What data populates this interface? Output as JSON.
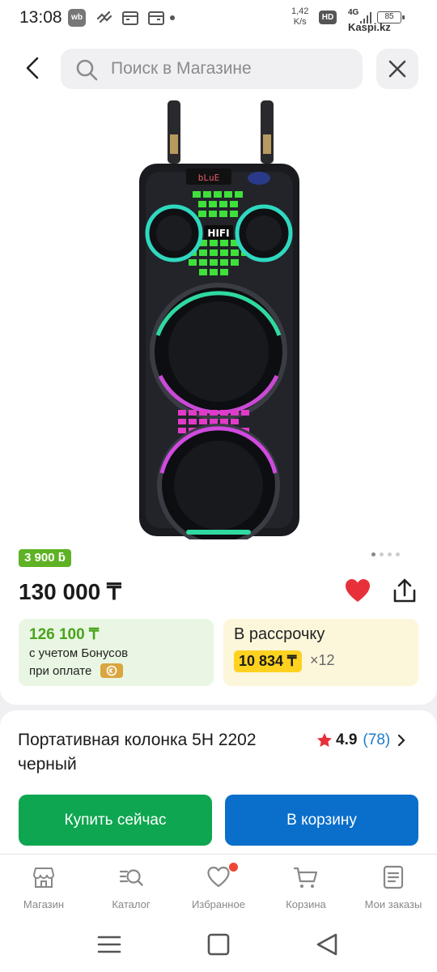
{
  "status_bar": {
    "time": "13:08",
    "wb_label": "wb",
    "net_speed_value": "1,42",
    "net_speed_unit": "K/s",
    "hd_label": "HD",
    "network_label": "4G",
    "battery": "85",
    "watermark": "Kaspi.kz"
  },
  "search": {
    "placeholder": "Поиск в Магазине"
  },
  "product": {
    "bonus_badge": "3 900 ƃ",
    "price": "130 000 ₸",
    "image_logo_text": "HIFI",
    "image_display_text": "bLuE",
    "title": "Портативная колонка 5H 2202 черный",
    "rating": "4.9",
    "reviews_count": "(78)"
  },
  "bonus_box": {
    "amount": "126 100 ₸",
    "line1": "с учетом Бонусов",
    "line2": "при оплате"
  },
  "installment": {
    "title": "В рассрочку",
    "monthly": "10 834 ₸",
    "months": "×12"
  },
  "actions": {
    "buy_now": "Купить сейчас",
    "add_to_cart": "В корзину"
  },
  "tabbar": {
    "items": [
      {
        "label": "Магазин",
        "icon": "store-icon"
      },
      {
        "label": "Каталог",
        "icon": "catalog-search-icon"
      },
      {
        "label": "Избранное",
        "icon": "heart-icon"
      },
      {
        "label": "Корзина",
        "icon": "cart-icon"
      },
      {
        "label": "Мои заказы",
        "icon": "orders-icon"
      }
    ]
  },
  "colors": {
    "green_accent": "#0ea650",
    "blue_accent": "#0a6fcb",
    "favorite_red": "#f14635",
    "installment_yellow": "#ffd21f"
  }
}
